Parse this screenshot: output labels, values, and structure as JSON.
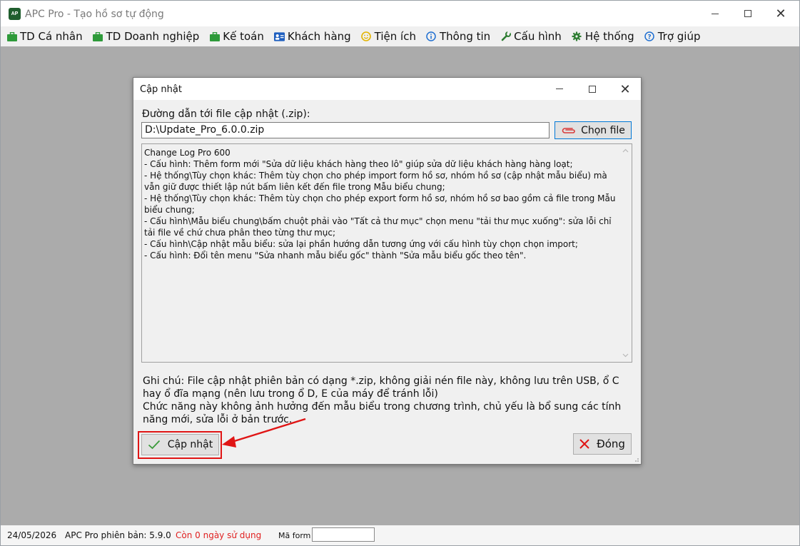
{
  "window": {
    "title": "APC Pro - Tạo hồ sơ tự động",
    "logo_text": "AP"
  },
  "menu": {
    "items": [
      {
        "label": "TD Cá nhân",
        "icon": "briefcase-icon",
        "color": "#2e9a3a"
      },
      {
        "label": "TD Doanh nghiệp",
        "icon": "briefcase-icon",
        "color": "#2e9a3a"
      },
      {
        "label": "Kế toán",
        "icon": "briefcase-icon",
        "color": "#2e9a3a"
      },
      {
        "label": "Khách hàng",
        "icon": "contact-card-icon",
        "color": "#1f5fbf"
      },
      {
        "label": "Tiện ích",
        "icon": "smiley-icon",
        "color": "#e3b400"
      },
      {
        "label": "Thông tin",
        "icon": "info-icon",
        "color": "#1f6fd1"
      },
      {
        "label": "Cấu hình",
        "icon": "wrench-icon",
        "color": "#2e7d32"
      },
      {
        "label": "Hệ thống",
        "icon": "gear-icon",
        "color": "#2e7d32"
      },
      {
        "label": "Trợ giúp",
        "icon": "help-icon",
        "color": "#1f6fd1"
      }
    ]
  },
  "dialog": {
    "title": "Cập nhật",
    "path_label": "Đường dẫn tới file cập nhật (.zip):",
    "path_value": "D:\\Update_Pro_6.0.0.zip",
    "choose_file_label": "Chọn file",
    "changelog": "Change Log Pro 600\n- Cấu hình: Thêm form mới \"Sửa dữ liệu khách hàng theo lô\" giúp sửa dữ liệu khách hàng hàng loạt;\n- Hệ thống\\Tùy chọn khác: Thêm tùy chọn cho phép import form hồ sơ, nhóm hồ sơ (cập nhật mẫu biểu) mà vẫn giữ được thiết lập nút bấm liên kết đến file trong Mẫu biểu chung;\n- Hệ thống\\Tùy chọn khác: Thêm tùy chọn cho phép export form hồ sơ, nhóm hồ sơ bao gồm cả file trong Mẫu biểu chung;\n- Cấu hình\\Mẫu biểu chung\\bấm chuột phải vào \"Tất cả thư mục\" chọn menu \"tải thư mục xuống\": sửa lỗi chỉ tải file về chứ chưa phân theo từng thư mục;\n- Cấu hình\\Cập nhật mẫu biểu: sửa lại phần hướng dẫn tương ứng với cấu hình tùy chọn chọn import;\n- Cấu hình: Đổi tên menu \"Sửa nhanh mẫu biểu gốc\" thành \"Sửa mẫu biểu gốc theo tên\".",
    "note": "Ghi chú: File cập nhật phiên bản có dạng *.zip, không giải nén file này, không lưu trên USB, ổ C hay ổ đĩa mạng (nên lưu trong ổ D, E của máy để tránh lỗi)\nChức năng này không ảnh hưởng đến mẫu biểu trong chương trình, chủ yếu là bổ sung các tính năng mới, sửa lỗi ở bản trước.",
    "update_label": "Cập nhật",
    "close_label": "Đóng"
  },
  "statusbar": {
    "date": "24/05/2026",
    "version": "APC Pro phiên bản: 5.9.0",
    "remaining": "Còn 0 ngày sử dụng",
    "maform_label": "Mã form",
    "maform_value": ""
  },
  "colors": {
    "accent": "#0078d7",
    "highlight_red": "#e01515",
    "menu_green": "#2e9a3a"
  }
}
